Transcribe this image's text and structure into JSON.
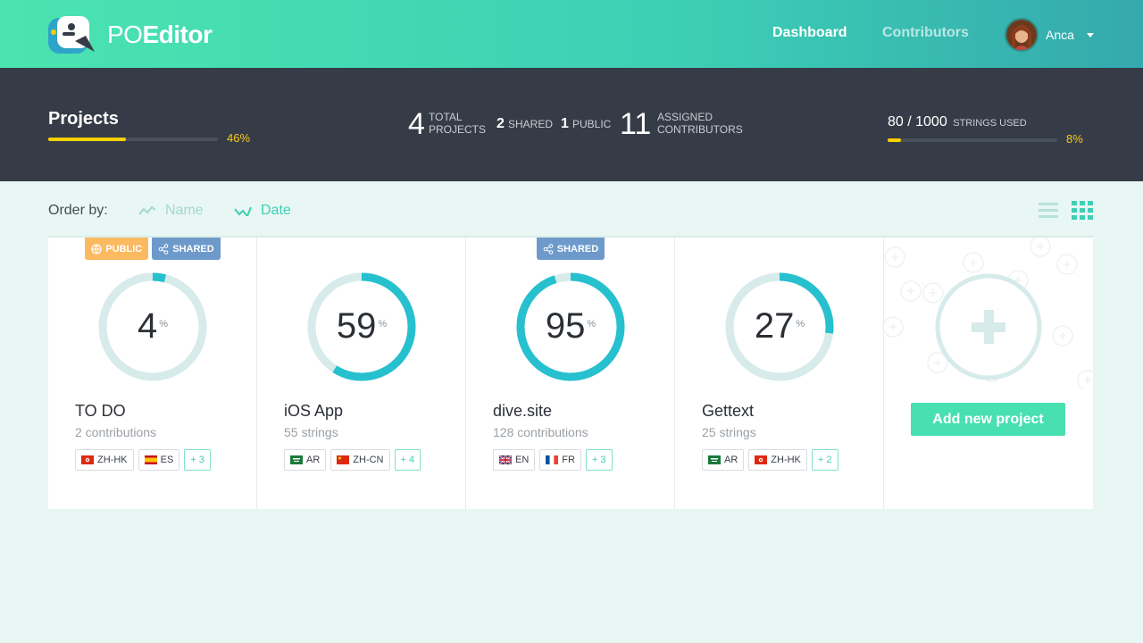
{
  "header": {
    "logo_po": "PO",
    "logo_editor": "Editor",
    "nav_dashboard": "Dashboard",
    "nav_contributors": "Contributors",
    "user_name": "Anca"
  },
  "stats": {
    "projects_title": "Projects",
    "projects_percent": "46%",
    "projects_progress": 0.46,
    "total_projects_num": "4",
    "total_label_1": "TOTAL",
    "total_label_2": "PROJECTS",
    "shared_num": "2",
    "shared_label": "SHARED",
    "public_num": "1",
    "public_label": "PUBLIC",
    "contributors_num": "11",
    "contributors_label_1": "ASSIGNED",
    "contributors_label_2": "CONTRIBUTORS",
    "strings_used": "80 / 1000",
    "strings_used_label": "STRINGS USED",
    "strings_percent": "8%",
    "strings_progress": 0.08
  },
  "order": {
    "label": "Order by:",
    "name_option": "Name",
    "date_option": "Date"
  },
  "projects": [
    {
      "name": "TO DO",
      "sub": "2 contributions",
      "percent": "4",
      "percent_value": 4,
      "badges": [
        "PUBLIC",
        "SHARED"
      ],
      "langs": [
        {
          "code": "ZH-HK",
          "flag": "hk"
        },
        {
          "code": "ES",
          "flag": "es"
        }
      ],
      "more": "+ 3"
    },
    {
      "name": "iOS App",
      "sub": "55 strings",
      "percent": "59",
      "percent_value": 59,
      "badges": [],
      "langs": [
        {
          "code": "AR",
          "flag": "sa"
        },
        {
          "code": "ZH-CN",
          "flag": "cn"
        }
      ],
      "more": "+ 4"
    },
    {
      "name": "dive.site",
      "sub": "128 contributions",
      "percent": "95",
      "percent_value": 95,
      "badges": [
        "SHARED"
      ],
      "langs": [
        {
          "code": "EN",
          "flag": "gb"
        },
        {
          "code": "FR",
          "flag": "fr"
        }
      ],
      "more": "+ 3"
    },
    {
      "name": "Gettext",
      "sub": "25 strings",
      "percent": "27",
      "percent_value": 27,
      "badges": [],
      "langs": [
        {
          "code": "AR",
          "flag": "sa"
        },
        {
          "code": "ZH-HK",
          "flag": "hk"
        }
      ],
      "more": "+ 2"
    }
  ],
  "percent_sign": "%",
  "add_project": "Add new project",
  "colors": {
    "accent": "#3dcfb5",
    "ring": "#26c0cf",
    "ring_track": "#d6ebea",
    "yellow": "#f7d000",
    "public_badge": "#fbb960",
    "shared_badge": "#6d9acb"
  },
  "icons": {
    "public": "globe-icon",
    "shared": "share-icon",
    "sort": "sort-trend-icon",
    "list_view": "list-view-icon",
    "grid_view": "grid-view-icon",
    "add": "plus-icon"
  }
}
